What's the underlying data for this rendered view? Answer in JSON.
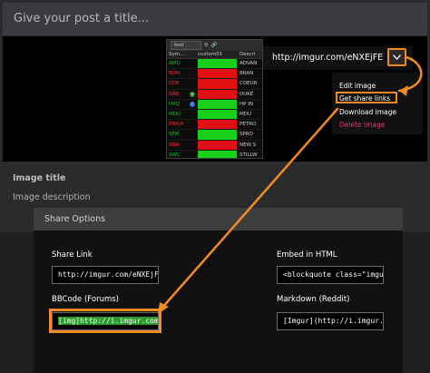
{
  "post": {
    "title_placeholder": "Give your post a title...",
    "image_title": "Image title",
    "image_description": "Image description"
  },
  "spreadsheet": {
    "tab_label": "test",
    "headers": [
      "Sym...",
      "custom01",
      "Descri"
    ],
    "rows": [
      {
        "symbol": "AMD",
        "status": "green",
        "desc": "ADVAN"
      },
      {
        "symbol": "BDN",
        "status": "red",
        "desc": "BRAN"
      },
      {
        "symbol": "CDE",
        "status": "red",
        "desc": "COEUR"
      },
      {
        "symbol": "DRE",
        "status": "red",
        "desc": "DUKE"
      },
      {
        "symbol": "HPQ",
        "status": "green",
        "desc": "HP IN"
      },
      {
        "symbol": "MDU",
        "status": "green",
        "desc": "MDU"
      },
      {
        "symbol": "PBR/A",
        "status": "red",
        "desc": "PETRO"
      },
      {
        "symbol": "SFM",
        "status": "green",
        "desc": "SPRO"
      },
      {
        "symbol": "SNR",
        "status": "red",
        "desc": "NEW S"
      },
      {
        "symbol": "SWC",
        "status": "green",
        "desc": "STILLW"
      }
    ]
  },
  "image_url": "http://imgur.com/eNXEjFE",
  "menu": {
    "items": [
      "Edit image",
      "Get share links",
      "Download image",
      "Delete image"
    ]
  },
  "share_options": {
    "heading": "Share Options",
    "share_link_label": "Share Link",
    "share_link_value": "http://imgur.com/eNXEjFE",
    "embed_label": "Embed in HTML",
    "embed_value": "<blockquote class=\"imgur-",
    "bbcode_label": "BBCode (Forums)",
    "bbcode_value": "[img]http://i.imgur.com/eN",
    "markdown_label": "Markdown (Reddit)",
    "markdown_value": "[Imgur](http://i.imgur.com"
  },
  "colors": {
    "accent_orange": "#f08a24",
    "sheet_green": "#19d019",
    "sheet_red": "#e01010",
    "delete_pink": "#e23a6e"
  }
}
